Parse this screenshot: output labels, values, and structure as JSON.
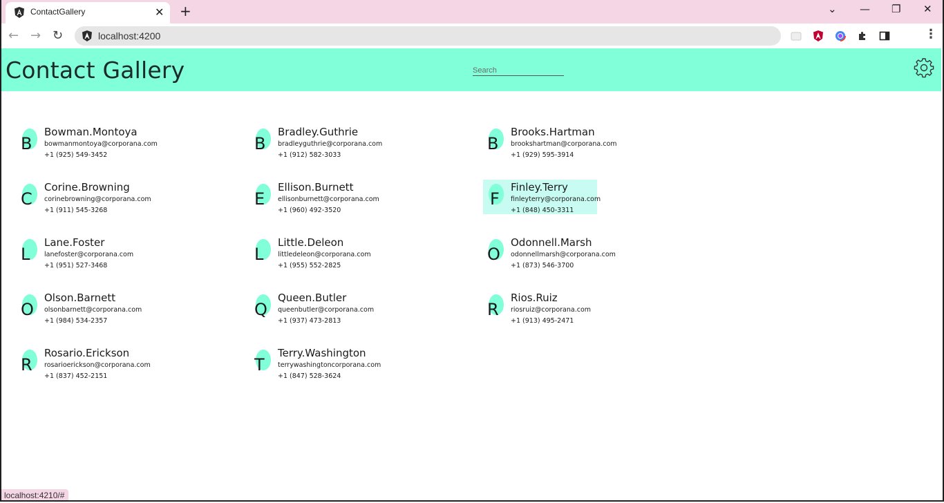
{
  "browser": {
    "tab_title": "ContactGallery",
    "url": "localhost:4200",
    "status_url": "localhost:4210/#"
  },
  "app": {
    "title": "Contact Gallery",
    "search_placeholder": "Search"
  },
  "contacts": [
    {
      "letter": "B",
      "name": "Bowman.Montoya",
      "email": "bowmanmontoya@corporana.com",
      "phone": "+1 (925) 549-3452"
    },
    {
      "letter": "B",
      "name": "Bradley.Guthrie",
      "email": "bradleyguthrie@corporana.com",
      "phone": "+1 (912) 582-3033"
    },
    {
      "letter": "B",
      "name": "Brooks.Hartman",
      "email": "brookshartman@corporana.com",
      "phone": "+1 (929) 595-3914"
    },
    {
      "letter": "C",
      "name": "Corine.Browning",
      "email": "corinebrowning@corporana.com",
      "phone": "+1 (911) 545-3268"
    },
    {
      "letter": "E",
      "name": "Ellison.Burnett",
      "email": "ellisonburnett@corporana.com",
      "phone": "+1 (960) 492-3520"
    },
    {
      "letter": "F",
      "name": "Finley.Terry",
      "email": "finleyterry@corporana.com",
      "phone": "+1 (848) 450-3311"
    },
    {
      "letter": "L",
      "name": "Lane.Foster",
      "email": "lanefoster@corporana.com",
      "phone": "+1 (951) 527-3468"
    },
    {
      "letter": "L",
      "name": "Little.Deleon",
      "email": "littledeleon@corporana.com",
      "phone": "+1 (955) 552-2825"
    },
    {
      "letter": "O",
      "name": "Odonnell.Marsh",
      "email": "odonnellmarsh@corporana.com",
      "phone": "+1 (873) 546-3700"
    },
    {
      "letter": "O",
      "name": "Olson.Barnett",
      "email": "olsonbarnett@corporana.com",
      "phone": "+1 (984) 534-2357"
    },
    {
      "letter": "Q",
      "name": "Queen.Butler",
      "email": "queenbutler@corporana.com",
      "phone": "+1 (937) 473-2813"
    },
    {
      "letter": "R",
      "name": "Rios.Ruiz",
      "email": "riosruiz@corporana.com",
      "phone": "+1 (913) 495-2471"
    },
    {
      "letter": "R",
      "name": "Rosario.Erickson",
      "email": "rosarioerickson@corporana.com",
      "phone": "+1 (837) 452-2151"
    },
    {
      "letter": "T",
      "name": "Terry.Washington",
      "email": "terrywashingtoncorporana.com",
      "phone": "+1 (847) 528-3624"
    }
  ],
  "colors": {
    "accent": "#80ffd8",
    "selected_card": "#c8fbf1",
    "tabstrip": "#f5d6e4"
  }
}
